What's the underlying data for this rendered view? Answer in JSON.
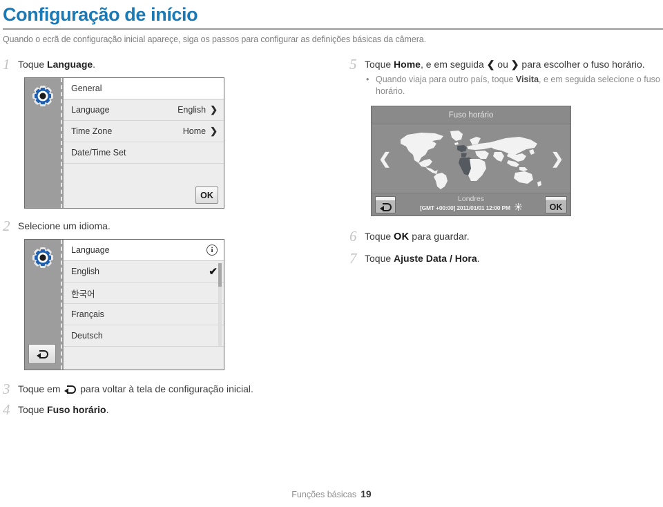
{
  "header": {
    "title": "Configuração de início",
    "subtitle": "Quando o ecrã de configuração inicial apareçe, siga os passos para configurar as definições básicas da câmera."
  },
  "steps": {
    "s1": {
      "num": "1",
      "pre": "Toque ",
      "bold": "Language",
      "post": "."
    },
    "s2": {
      "num": "2",
      "pre": "Selecione um idioma.",
      "bold": "",
      "post": ""
    },
    "s3": {
      "num": "3",
      "pre": "Toque em ",
      "post": " para voltar à tela de configuração inicial."
    },
    "s4": {
      "num": "4",
      "pre": "Toque ",
      "bold": "Fuso horário",
      "post": "."
    },
    "s5": {
      "num": "5",
      "pre": "Toque ",
      "bold": "Home",
      "mid": ", e em seguida ",
      "arrow_left": "❮",
      "mid2": " ou ",
      "arrow_right": "❯",
      "post": " para escolher o fuso horário.",
      "bullet_pre": "Quando viaja para outro país, toque ",
      "bullet_bold": "Visita",
      "bullet_post": ", e em seguida selecione o fuso horário."
    },
    "s6": {
      "num": "6",
      "pre": "Toque ",
      "bold": "OK",
      "post": " para guardar."
    },
    "s7": {
      "num": "7",
      "pre": "Toque ",
      "bold": "Ajuste Data / Hora",
      "post": "."
    }
  },
  "screen_general": {
    "header_label": "General",
    "rows": [
      {
        "label": "Language",
        "value": "English",
        "chevron": "❯"
      },
      {
        "label": "Time Zone",
        "value": "Home",
        "chevron": "❯"
      },
      {
        "label": "Date/Time Set",
        "value": "",
        "chevron": ""
      }
    ],
    "ok_label": "OK",
    "gear_icon": "gear-icon"
  },
  "screen_language": {
    "header_label": "Language",
    "info_icon": "i",
    "items": [
      {
        "label": "English",
        "selected_mark": "✔"
      },
      {
        "label": "한국어",
        "selected_mark": ""
      },
      {
        "label": "Français",
        "selected_mark": ""
      },
      {
        "label": "Deutsch",
        "selected_mark": ""
      }
    ],
    "back_icon": "back-arrow-icon"
  },
  "screen_timezone": {
    "title": "Fuso horário",
    "arrow_left": "❮",
    "arrow_right": "❯",
    "city": "Londres",
    "stamp": "[GMT +00:00] 2011/01/01 12:00 PM",
    "ok_label": "OK",
    "back_icon": "back-arrow-icon",
    "sun_icon": "sun-icon"
  },
  "footer": {
    "section": "Funções básicas",
    "page": "19"
  },
  "colors": {
    "title_blue": "#1b7ab5",
    "rule_gray": "#9a9a9a",
    "step_num_gray": "#c3c3c3",
    "body_text": "#3a3a3a",
    "muted_text": "#8a8a8a",
    "screen_bg": "#9a9a9a",
    "list_bg": "#ededed",
    "map_bg": "#8e8e8e",
    "gear_blue": "#1f5fb0"
  }
}
